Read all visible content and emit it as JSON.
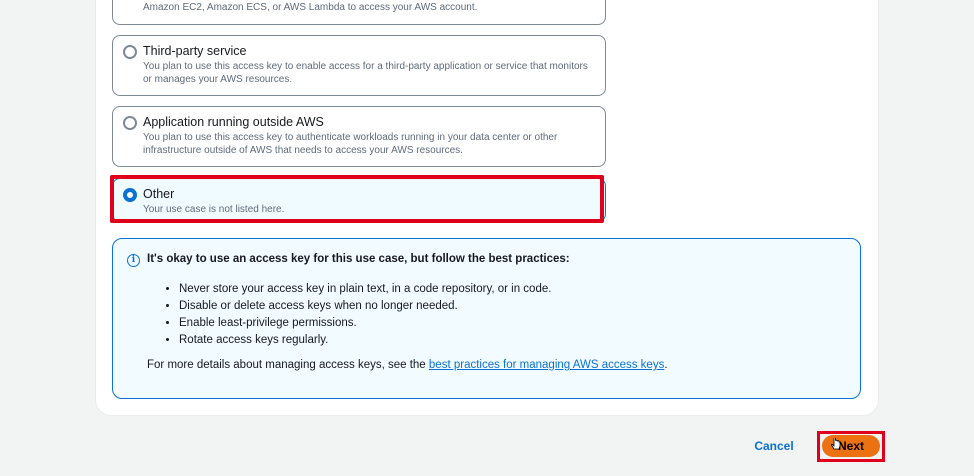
{
  "options": [
    {
      "title": "",
      "description": "Amazon EC2, Amazon ECS, or AWS Lambda to access your AWS account.",
      "selected": false
    },
    {
      "title": "Third-party service",
      "description": "You plan to use this access key to enable access for a third-party application or service that monitors or manages your AWS resources.",
      "selected": false
    },
    {
      "title": "Application running outside AWS",
      "description": "You plan to use this access key to authenticate workloads running in your data center or other infrastructure outside of AWS that needs to access your AWS resources.",
      "selected": false
    },
    {
      "title": "Other",
      "description": "Your use case is not listed here.",
      "selected": true
    }
  ],
  "alert": {
    "icon": "info-icon",
    "title": "It's okay to use an access key for this use case, but follow the best practices:",
    "items": [
      "Never store your access key in plain text, in a code repository, or in code.",
      "Disable or delete access keys when no longer needed.",
      "Enable least-privilege permissions.",
      "Rotate access keys regularly."
    ],
    "footer_prefix": "For more details about managing access keys, see the ",
    "footer_link": "best practices for managing AWS access keys",
    "footer_suffix": "."
  },
  "actions": {
    "cancel_label": "Cancel",
    "next_label": "Next"
  },
  "colors": {
    "accent": "#0972d3",
    "primary_button": "#ec7211",
    "highlight": "#e0001b"
  }
}
